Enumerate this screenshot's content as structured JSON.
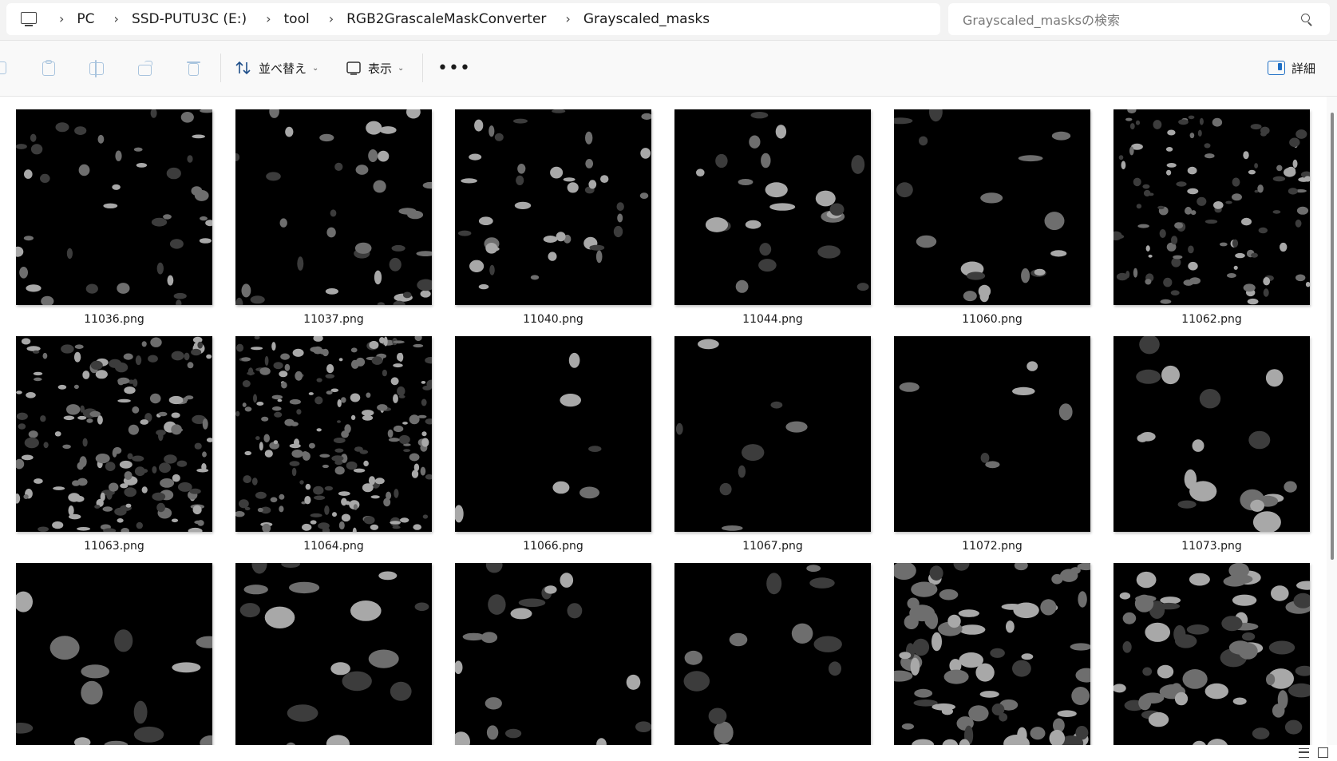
{
  "address": {
    "crumbs": [
      "PC",
      "SSD-PUTU3C (E:)",
      "tool",
      "RGB2GrascaleMaskConverter",
      "Grayscaled_masks"
    ]
  },
  "search": {
    "placeholder": "Grayscaled_masksの検索"
  },
  "toolbar": {
    "sort_label": "並べ替え",
    "view_label": "表示",
    "more_label": "•••",
    "details_label": "詳細"
  },
  "files": [
    {
      "name": "11036.png"
    },
    {
      "name": "11037.png"
    },
    {
      "name": "11040.png"
    },
    {
      "name": "11044.png"
    },
    {
      "name": "11060.png"
    },
    {
      "name": "11062.png"
    },
    {
      "name": "11063.png"
    },
    {
      "name": "11064.png"
    },
    {
      "name": "11066.png"
    },
    {
      "name": "11067.png"
    },
    {
      "name": "11072.png"
    },
    {
      "name": "11073.png"
    },
    {
      "name": ""
    },
    {
      "name": ""
    },
    {
      "name": ""
    },
    {
      "name": ""
    },
    {
      "name": ""
    },
    {
      "name": ""
    }
  ],
  "colors": {
    "accent": "#1f6fc5",
    "thumb_bg": "#000000",
    "blob_dark": "#3c3c3c",
    "blob_mid": "#6e6e6e",
    "blob_light": "#a8a8a8"
  }
}
